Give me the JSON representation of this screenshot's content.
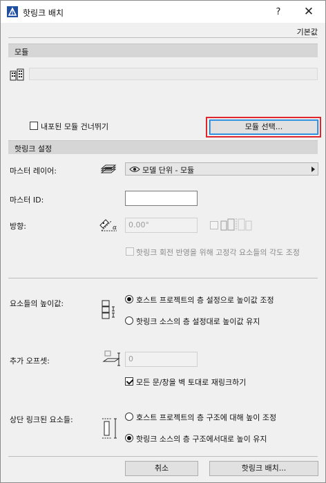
{
  "window": {
    "title": "핫링크 배치",
    "help_label": "?",
    "close_label": "✕",
    "defaults_label": "기본값"
  },
  "module_section": {
    "heading": "모듈",
    "skip_nested_label": "내포된 모듈 건너뛰기",
    "skip_nested_checked": false,
    "select_button_label": "모듈 선택..."
  },
  "hotlink_settings": {
    "heading": "핫링크 설정",
    "master_layer_label": "마스터 레이어:",
    "master_layer_value": "모델 단위 - 모듈",
    "master_id_label": "마스터 ID:",
    "master_id_value": "",
    "orientation_label": "방향:",
    "orientation_value": "0.00°",
    "fixed_angle_label": "핫링크 회전 반영을 위해 고정각 요소들의 각도 조정",
    "fixed_angle_checked": false
  },
  "elevation": {
    "label": "요소들의 높이값:",
    "options": [
      "호스트 프로젝트의 층 설정으로 높이값 조정",
      "핫링크 소스의 층 설정대로 높이값 유지"
    ],
    "selected_index": 0
  },
  "offset": {
    "label": "추가 오프셋:",
    "value": "0",
    "relink_label": "모든 문/창을 벽 토대로 재링크하기",
    "relink_checked": true
  },
  "top_linked": {
    "label": "상단 링크된 요소들:",
    "options": [
      "호스트 프로젝트의 층 구조에 대해 높이 조정",
      "핫링크 소스의 층 구조에서대로 높이 유지"
    ],
    "selected_index": 1
  },
  "footer": {
    "cancel_label": "취소",
    "place_label": "핫링크 배치..."
  },
  "colors": {
    "highlight": "#e0262b",
    "section_bg": "#d6d6d6",
    "focus": "#0078d7"
  }
}
